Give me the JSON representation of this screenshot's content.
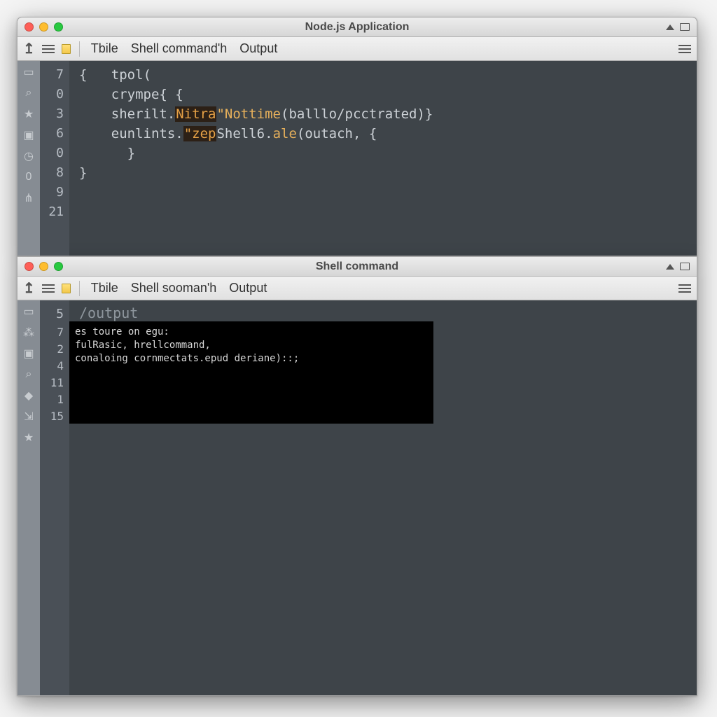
{
  "window1": {
    "title": "Node.js Application",
    "toolbar": {
      "items": [
        "Tbile",
        "Shell command'h",
        "Output"
      ]
    },
    "sidebar_icons": [
      "file-icon",
      "search-icon",
      "star-icon",
      "folder-icon",
      "history-icon",
      "zero-badge",
      "anchor-icon"
    ],
    "line_numbers": [
      "7",
      "0",
      "3",
      "6",
      "0",
      "8",
      "9",
      "21"
    ],
    "code": {
      "l1a": "{",
      "l1b": "tpol(",
      "l2": "crympe{ {",
      "l3a": "sherilt.",
      "l3b": "Nitra",
      "l3c": "\"Nottime",
      "l3d": "(balllo",
      "l3e": "pcctrated)}",
      "l4a": "eunlints.",
      "l4b": "\"zep",
      "l4c": "Shell6.",
      "l4d": "ale",
      "l4e": "(outach, {",
      "l5": "}",
      "l6": "}"
    }
  },
  "window2": {
    "title": "Shell command",
    "toolbar": {
      "items": [
        "Tbile",
        "Shell sooman'h",
        "Output"
      ]
    },
    "sidebar_icons": [
      "file-icon",
      "pulse-icon",
      "folder-icon",
      "search-icon",
      "tag-icon",
      "export-icon",
      "star-icon"
    ],
    "line_numbers": [
      "5",
      "7",
      "2",
      "4",
      "11",
      "1",
      "15"
    ],
    "prompt": "/output",
    "terminal": {
      "l1": "es toure on egu:",
      "l2": "     fulRasic, hrellcommand,",
      "l3": "conaloing cornmectats.epud deriane)::;"
    }
  }
}
